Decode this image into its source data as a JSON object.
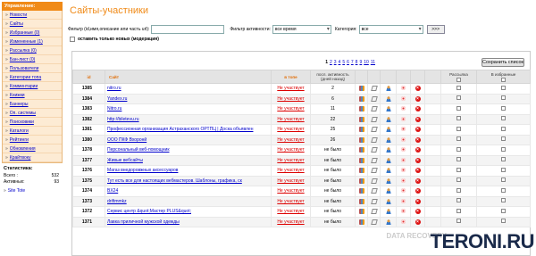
{
  "sidebar": {
    "header": "Управление:",
    "items": [
      "Новости",
      "Сайты",
      "Избранные (0)",
      "Измененные (1)",
      "Рассылка (0)",
      "Бан-лист (0)",
      "Пользователи",
      "Категории топа",
      "Комментарии",
      "Книжки",
      "Баннеры",
      "Оп. системы",
      "Поисковики",
      "Каталоги",
      "Рейтинги",
      "Обновления",
      "Крайтвоку"
    ],
    "stats": {
      "title": "Статистика:",
      "total_label": "Всего :",
      "total": "532",
      "active_label": "Активных:",
      "active": "93"
    },
    "site_test": "Site Tote"
  },
  "page": {
    "title": "Сайты-участники"
  },
  "filters": {
    "text_label": "Фильтр (id,имя,описание или часть url):",
    "text_value": "",
    "activity_label": "Фильтр активности:",
    "activity_value": "все время",
    "category_label": "Категория:",
    "category_value": "все",
    "go": ">>>",
    "new_only": "оставить только новых (модерация)"
  },
  "pager": {
    "pages": [
      "1",
      "2",
      "3",
      "4",
      "5",
      "6",
      "7",
      "8",
      "9",
      "10",
      "11"
    ],
    "current": "1"
  },
  "save_button": "Сохранить список",
  "columns": {
    "id": "id",
    "site": "Сайт",
    "top": "в топе",
    "activity": "посл. активность (дней назад)",
    "mailing": "Рассылка",
    "favorites": "В избранные"
  },
  "rows": [
    {
      "id": "1385",
      "name": "nitro.ru",
      "status": "Не участвует",
      "days": "2"
    },
    {
      "id": "1384",
      "name": "Yandex.ru",
      "status": "Не участвует",
      "days": "6"
    },
    {
      "id": "1383",
      "name": "Nitro.ru",
      "status": "Не участвует",
      "days": "11"
    },
    {
      "id": "1382",
      "name": "http://biletevu.ru",
      "status": "Не участвует",
      "days": "22"
    },
    {
      "id": "1381",
      "name": "Профессионная организация Астраханского ОРТПЦ | Доска объявлен",
      "status": "Не участвует",
      "days": "25"
    },
    {
      "id": "1380",
      "name": "ООО ПКФ Вхоронй",
      "status": "Не участвует",
      "days": "26"
    },
    {
      "id": "1378",
      "name": "Персональный веб-помощник",
      "status": "Не участвует",
      "days": "не было"
    },
    {
      "id": "1377",
      "name": "Живые вебсайты",
      "status": "Не участвует",
      "days": "не было"
    },
    {
      "id": "1376",
      "name": "Магаз внедоровжных аксессуаров",
      "status": "Не участвует",
      "days": "не было"
    },
    {
      "id": "1375",
      "name": "Тут есть все для настоящих вебмастеров. Шаблоны, графика, ск",
      "status": "Не участвует",
      "days": "не было"
    },
    {
      "id": "1374",
      "name": "BX24",
      "status": "Не участвует",
      "days": "не было"
    },
    {
      "id": "1373",
      "name": "driftmmkz",
      "status": "Не участвует",
      "days": "не было"
    },
    {
      "id": "1372",
      "name": "Сервис центр &quot;Мастер PLUS&quot;",
      "status": "Не участвует",
      "days": "не было"
    },
    {
      "id": "1371",
      "name": "Лавка приличной мужской одежды",
      "status": "Не участвует",
      "days": "не было"
    }
  ],
  "watermark": {
    "text": "TERONI.RU",
    "faint": "DATA RECOVERY"
  },
  "colors": {
    "accent": "#f08a17",
    "link": "#0000cc",
    "status": "#dd0000"
  }
}
